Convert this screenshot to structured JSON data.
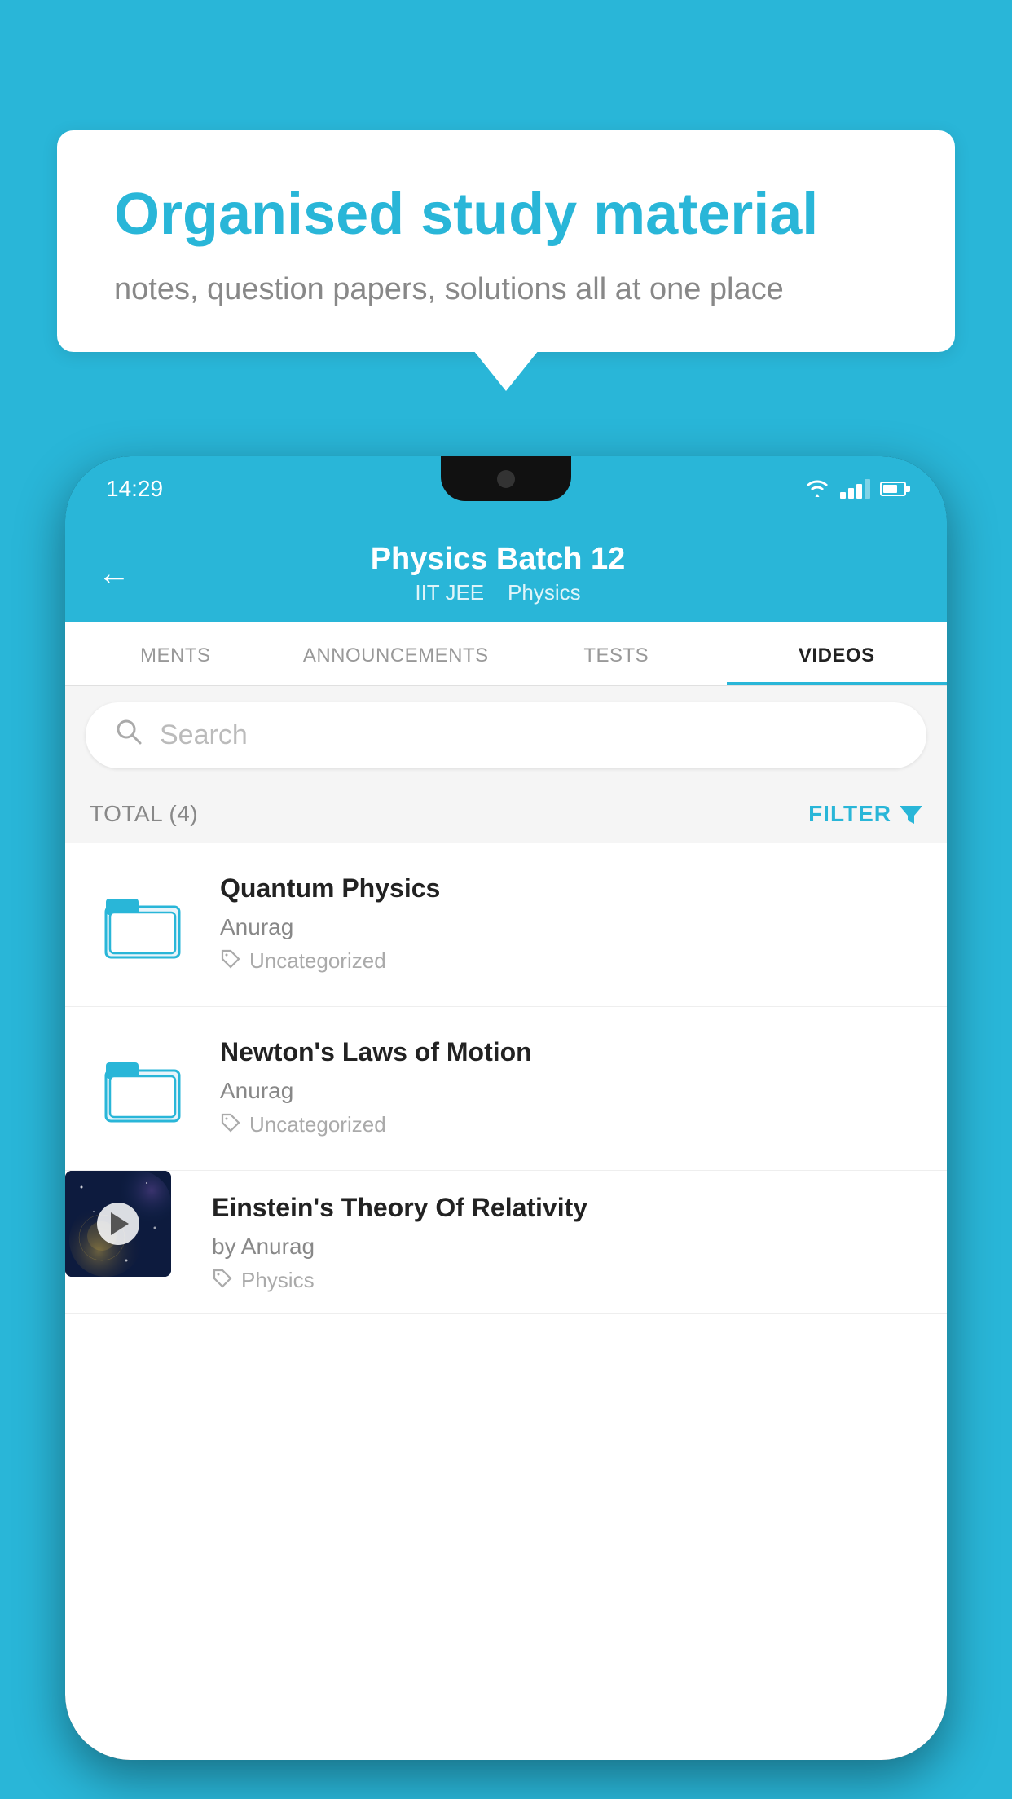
{
  "background_color": "#29b6d8",
  "speech_bubble": {
    "title": "Organised study material",
    "subtitle": "notes, question papers, solutions all at one place"
  },
  "status_bar": {
    "time": "14:29",
    "wifi": true,
    "signal": true,
    "battery": true
  },
  "app_header": {
    "title": "Physics Batch 12",
    "subtitle_part1": "IIT JEE",
    "subtitle_part2": "Physics",
    "back_label": "←"
  },
  "tabs": [
    {
      "label": "MENTS",
      "active": false
    },
    {
      "label": "ANNOUNCEMENTS",
      "active": false
    },
    {
      "label": "TESTS",
      "active": false
    },
    {
      "label": "VIDEOS",
      "active": true
    }
  ],
  "search": {
    "placeholder": "Search"
  },
  "filter_bar": {
    "total_label": "TOTAL (4)",
    "filter_label": "FILTER"
  },
  "videos": [
    {
      "id": 1,
      "title": "Quantum Physics",
      "author": "Anurag",
      "tag": "Uncategorized",
      "type": "folder",
      "has_thumbnail": false
    },
    {
      "id": 2,
      "title": "Newton's Laws of Motion",
      "author": "Anurag",
      "tag": "Uncategorized",
      "type": "folder",
      "has_thumbnail": false
    },
    {
      "id": 3,
      "title": "Einstein's Theory Of Relativity",
      "author_prefix": "by",
      "author": "Anurag",
      "tag": "Physics",
      "type": "video",
      "has_thumbnail": true
    }
  ]
}
